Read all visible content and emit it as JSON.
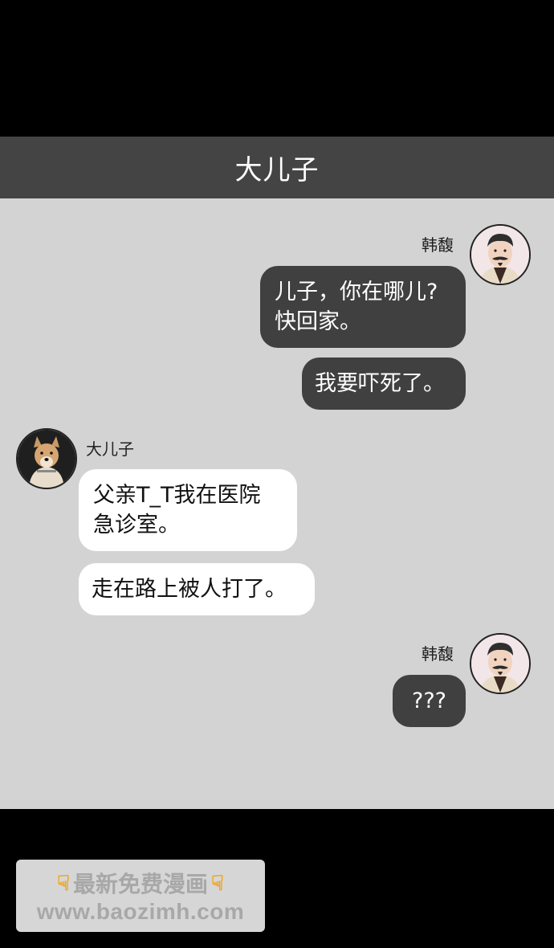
{
  "header": {
    "title": "大儿子"
  },
  "messages": [
    {
      "sender": "韩馥",
      "side": "right",
      "avatar_icon": "old-man-avatar-icon",
      "bubbles": [
        "儿子，你在哪儿?\n快回家。",
        "我要吓死了。"
      ]
    },
    {
      "sender": "大儿子",
      "side": "left",
      "avatar_icon": "dog-avatar-icon",
      "bubbles": [
        "父亲T_T我在医院\n急诊室。",
        "走在路上被人打了。"
      ]
    },
    {
      "sender": "韩馥",
      "side": "right",
      "avatar_icon": "old-man-avatar-icon",
      "bubbles": [
        "???"
      ]
    }
  ],
  "watermark": {
    "line1": "最新免费漫画",
    "line2": "www.baozimh.com",
    "icon": "pointing-down-hand-icon"
  },
  "colors": {
    "header_bg": "#444444",
    "chat_bg": "#d3d3d3",
    "outgoing_bubble": "#404040",
    "incoming_bubble": "#ffffff"
  }
}
